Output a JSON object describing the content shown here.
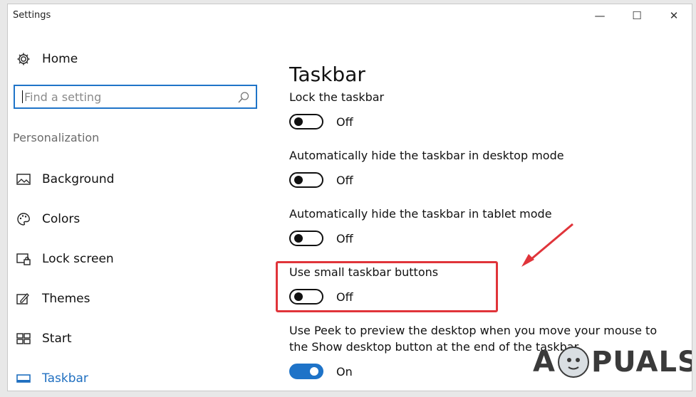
{
  "window": {
    "title": "Settings",
    "minimize_glyph": "—",
    "maximize_glyph": "☐",
    "close_glyph": "✕"
  },
  "sidebar": {
    "home_label": "Home",
    "search_placeholder": "Find a setting",
    "section_label": "Personalization",
    "items": [
      {
        "label": "Background",
        "icon": "background-icon"
      },
      {
        "label": "Colors",
        "icon": "colors-icon"
      },
      {
        "label": "Lock screen",
        "icon": "lock-screen-icon"
      },
      {
        "label": "Themes",
        "icon": "themes-icon"
      },
      {
        "label": "Start",
        "icon": "start-icon"
      },
      {
        "label": "Taskbar",
        "icon": "taskbar-icon",
        "active": true
      }
    ]
  },
  "main": {
    "title": "Taskbar",
    "settings": [
      {
        "label": "Lock the taskbar",
        "state": "Off",
        "on": false
      },
      {
        "label": "Automatically hide the taskbar in desktop mode",
        "state": "Off",
        "on": false
      },
      {
        "label": "Automatically hide the taskbar in tablet mode",
        "state": "Off",
        "on": false
      },
      {
        "label": "Use small taskbar buttons",
        "state": "Off",
        "on": false
      },
      {
        "label": "Use Peek to preview the desktop when you move your mouse to the Show desktop button at the end of the taskbar",
        "state": "On",
        "on": true
      }
    ]
  },
  "annotation": {
    "highlight_color": "#e0343a"
  },
  "watermark": {
    "text_left": "A",
    "text_right": "PUALS"
  },
  "colors": {
    "accent": "#1e73c8"
  }
}
